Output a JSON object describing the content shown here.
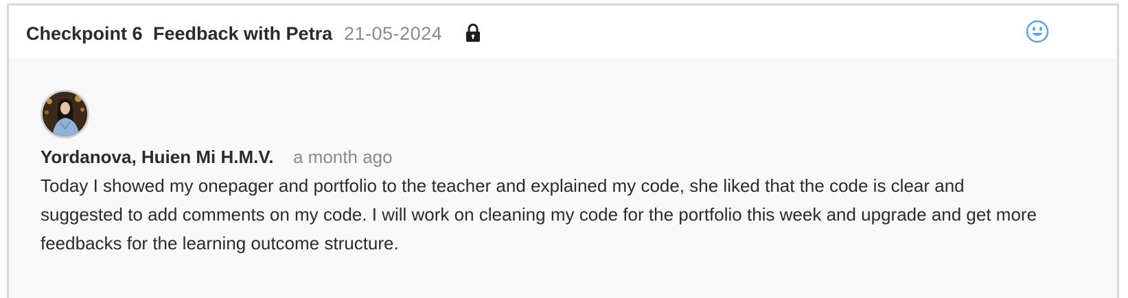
{
  "header": {
    "checkpoint_label": "Checkpoint 6",
    "title": "Feedback with Petra",
    "date": "21-05-2024",
    "lock_icon": "lock-icon",
    "reaction_icon": "smiley-icon"
  },
  "comment": {
    "author": "Yordanova, Huien Mi H.M.V.",
    "time": "a month ago",
    "text": "Today I showed my onepager and portfolio to the teacher and explained my code, she liked that the code is clear and suggested to add comments on my code. I will work on cleaning my code for the portfolio this week and upgrade and get more feedbacks for the learning outcome structure."
  },
  "colors": {
    "accent": "#5aa6e0",
    "border": "#d8d8d8",
    "body_background": "#f8f8f8",
    "muted_text": "#8a8a8a",
    "text": "#2b2b2b"
  }
}
